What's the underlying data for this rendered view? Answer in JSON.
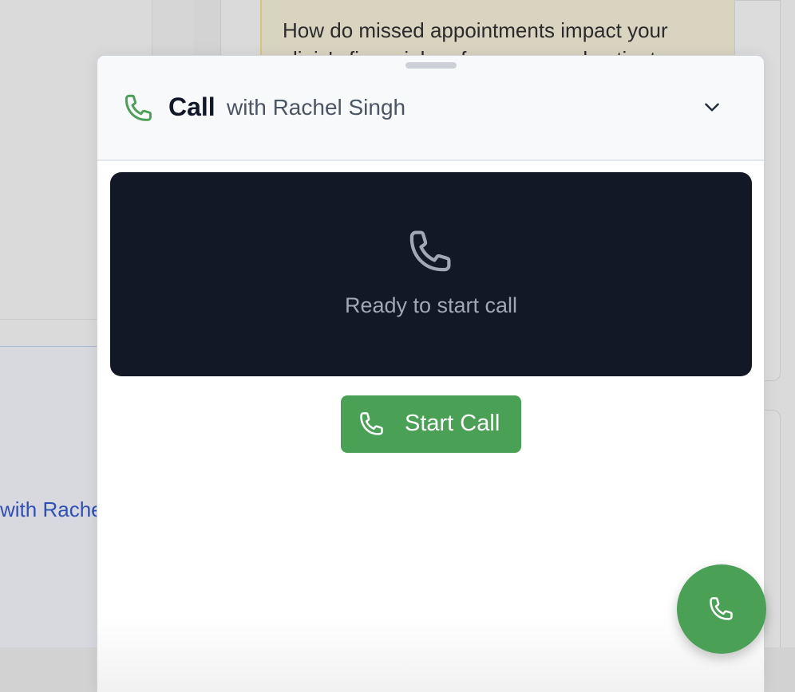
{
  "background": {
    "question_text": "How do missed appointments impact your clinic's financial performance and patient",
    "left_link_text": "with Rachel Singh"
  },
  "call_panel": {
    "title": "Call",
    "subtitle": "with Rachel Singh",
    "header_icon": "phone-icon",
    "collapse_icon": "chevron-down-icon",
    "stage": {
      "status_text": "Ready to start call",
      "icon": "phone-icon"
    },
    "start_button": {
      "label": "Start Call",
      "icon": "phone-icon"
    }
  },
  "fab": {
    "icon": "phone-icon"
  },
  "colors": {
    "accent_green": "#4aa155",
    "stage_background": "#121826",
    "title_text": "#111827",
    "link_blue": "#2f4fb5"
  }
}
